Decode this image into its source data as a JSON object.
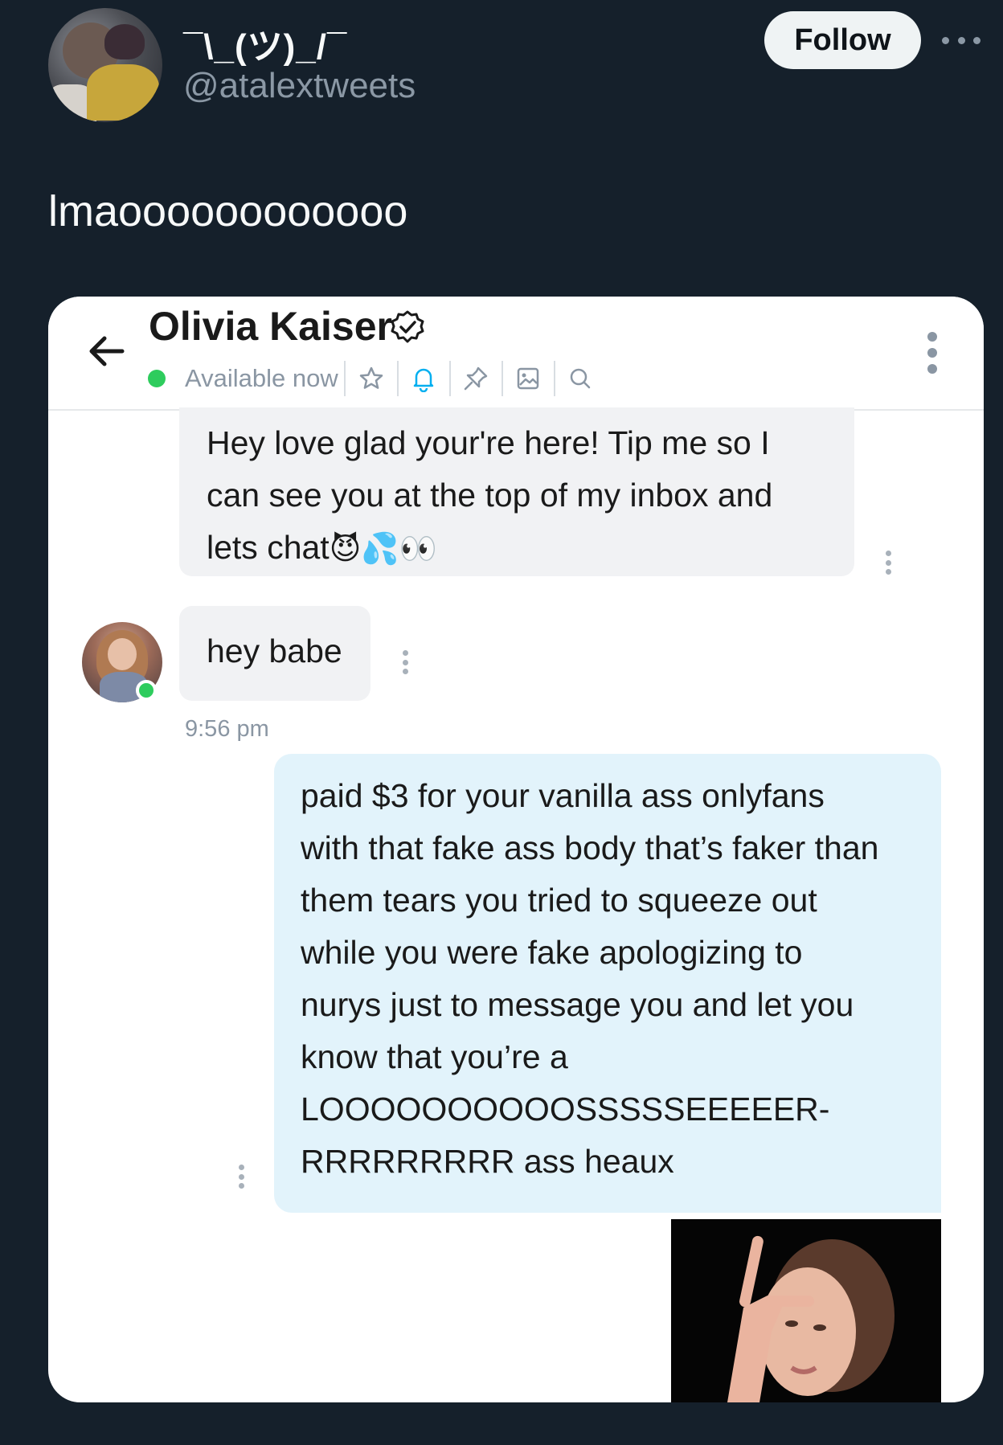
{
  "tweet": {
    "display_name": "¯\\_(ツ)_/¯",
    "handle": "@atalextweets",
    "follow_label": "Follow",
    "text": "lmaoooooooooooo"
  },
  "chat": {
    "contact_name": "Olivia Kaiser",
    "status": "Available now",
    "toolbar_icons": [
      "star-icon",
      "bell-icon",
      "pin-icon",
      "image-icon",
      "search-icon"
    ],
    "accent_color": "#00aff0",
    "messages": [
      {
        "direction": "incoming",
        "text": "Hey love glad your're here! Tip me so I can see you at the top of my inbox and lets chat",
        "emojis": "😈💦👀"
      },
      {
        "direction": "incoming",
        "text": "hey babe",
        "time": "9:56 pm"
      },
      {
        "direction": "outgoing",
        "lines": [
          "paid $3 for your vanilla ass onlyfans",
          "with that fake ass body that’s faker than",
          "them tears you tried to squeeze out",
          "while you were fake apologizing to",
          "nurys just to message you and let you",
          "know that you’re a",
          "LOOOOOOOOOOSSSSSEEEEER-",
          "RRRRRRRRR ass heaux"
        ]
      }
    ]
  }
}
